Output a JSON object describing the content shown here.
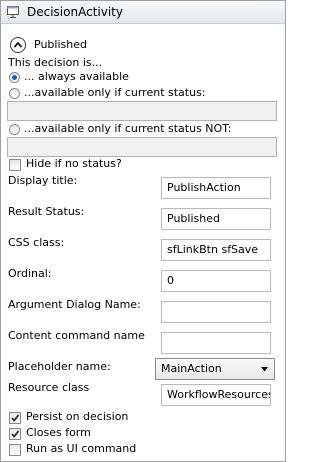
{
  "window": {
    "title": "DecisionActivity"
  },
  "section": {
    "title": "Published"
  },
  "availability": {
    "heading": "This decision is...",
    "options": [
      "... always available",
      "...available only if current status:",
      "...available only if current status NOT:"
    ],
    "selected": 0
  },
  "hide_if_no_status": {
    "label": "Hide if no status?",
    "checked": false
  },
  "fields": {
    "display_title": {
      "label": "Display title:",
      "value": "PublishAction"
    },
    "result_status": {
      "label": "Result Status:",
      "value": "Published"
    },
    "css_class": {
      "label": "CSS class:",
      "value": "sfLinkBtn sfSave"
    },
    "ordinal": {
      "label": "Ordinal:",
      "value": "0"
    },
    "argument_dialog_name": {
      "label": "Argument Dialog Name:",
      "value": ""
    },
    "content_command_name": {
      "label": "Content command name",
      "value": ""
    },
    "placeholder_name": {
      "label": "Placeholder name:",
      "value": "MainAction"
    },
    "resource_class": {
      "label": "Resource class",
      "value": "WorkflowResources"
    }
  },
  "checkboxes": {
    "persist_on_decision": {
      "label": "Persist on decision",
      "checked": true
    },
    "closes_form": {
      "label": "Closes form",
      "checked": true
    },
    "run_as_ui_command": {
      "label": "Run as UI command",
      "checked": false
    }
  },
  "colors": {
    "radio_dot": "#2a5db0",
    "check": "#2b2b2b",
    "window_border": "#a0a0a0"
  }
}
